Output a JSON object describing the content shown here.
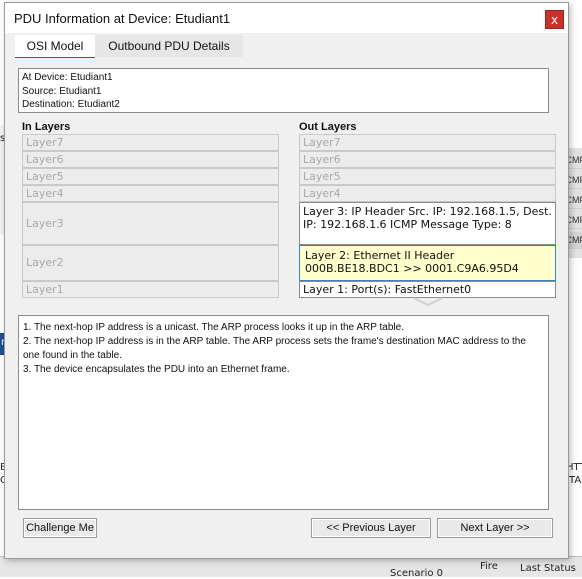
{
  "window": {
    "title": "PDU Information at Device: Etudiant1",
    "close_label": "x"
  },
  "tabs": [
    {
      "label": "OSI Model",
      "selected": true
    },
    {
      "label": "Outbound PDU Details",
      "selected": false
    }
  ],
  "info": {
    "lines": [
      "At Device: Etudiant1",
      "Source: Etudiant1",
      "Destination: Etudiant2"
    ]
  },
  "in_layers": {
    "title": "In Layers",
    "items": [
      "Layer7",
      "Layer6",
      "Layer5",
      "Layer4",
      "Layer3",
      "Layer2",
      "Layer1"
    ]
  },
  "out_layers": {
    "title": "Out Layers",
    "items": [
      "Layer7",
      "Layer6",
      "Layer5",
      "Layer4",
      "Layer 3: IP Header Src. IP: 192.168.1.5, Dest. IP: 192.168.1.6 ICMP Message Type: 8",
      "Layer 2: Ethernet II Header 000B.BE18.BDC1 >> 0001.C9A6.95D4",
      "Layer 1: Port(s): FastEthernet0"
    ]
  },
  "description": {
    "lines": [
      "1. The next-hop IP address is a unicast. The ARP process looks it up in the ARP table.",
      "2. The next-hop IP address is in the ARP table. The ARP process sets the frame's destination MAC address to the one found in the table.",
      "3. The device encapsulates the PDU into an Ethernet frame."
    ]
  },
  "buttons": {
    "challenge": "Challenge Me",
    "previous": "<< Previous Layer",
    "next": "Next Layer >>"
  },
  "background": {
    "right_fragments": [
      "ICMP",
      "ICMP",
      "ICMP",
      "ICMP",
      "ICMP"
    ],
    "left_fragments": [
      "se",
      "n"
    ],
    "bottom_left": [
      "BC",
      "OS"
    ],
    "bottom_right": [
      "HTT",
      "TA"
    ],
    "status_fragments": [
      "Fire",
      "Last Status",
      "Scenario 0"
    ]
  },
  "colors": {
    "selected_layer_bg": "#ffffcc",
    "selected_layer_border": "#3b83c4",
    "close_button": "#c8322a",
    "tab_underline": "#1e62a8"
  }
}
